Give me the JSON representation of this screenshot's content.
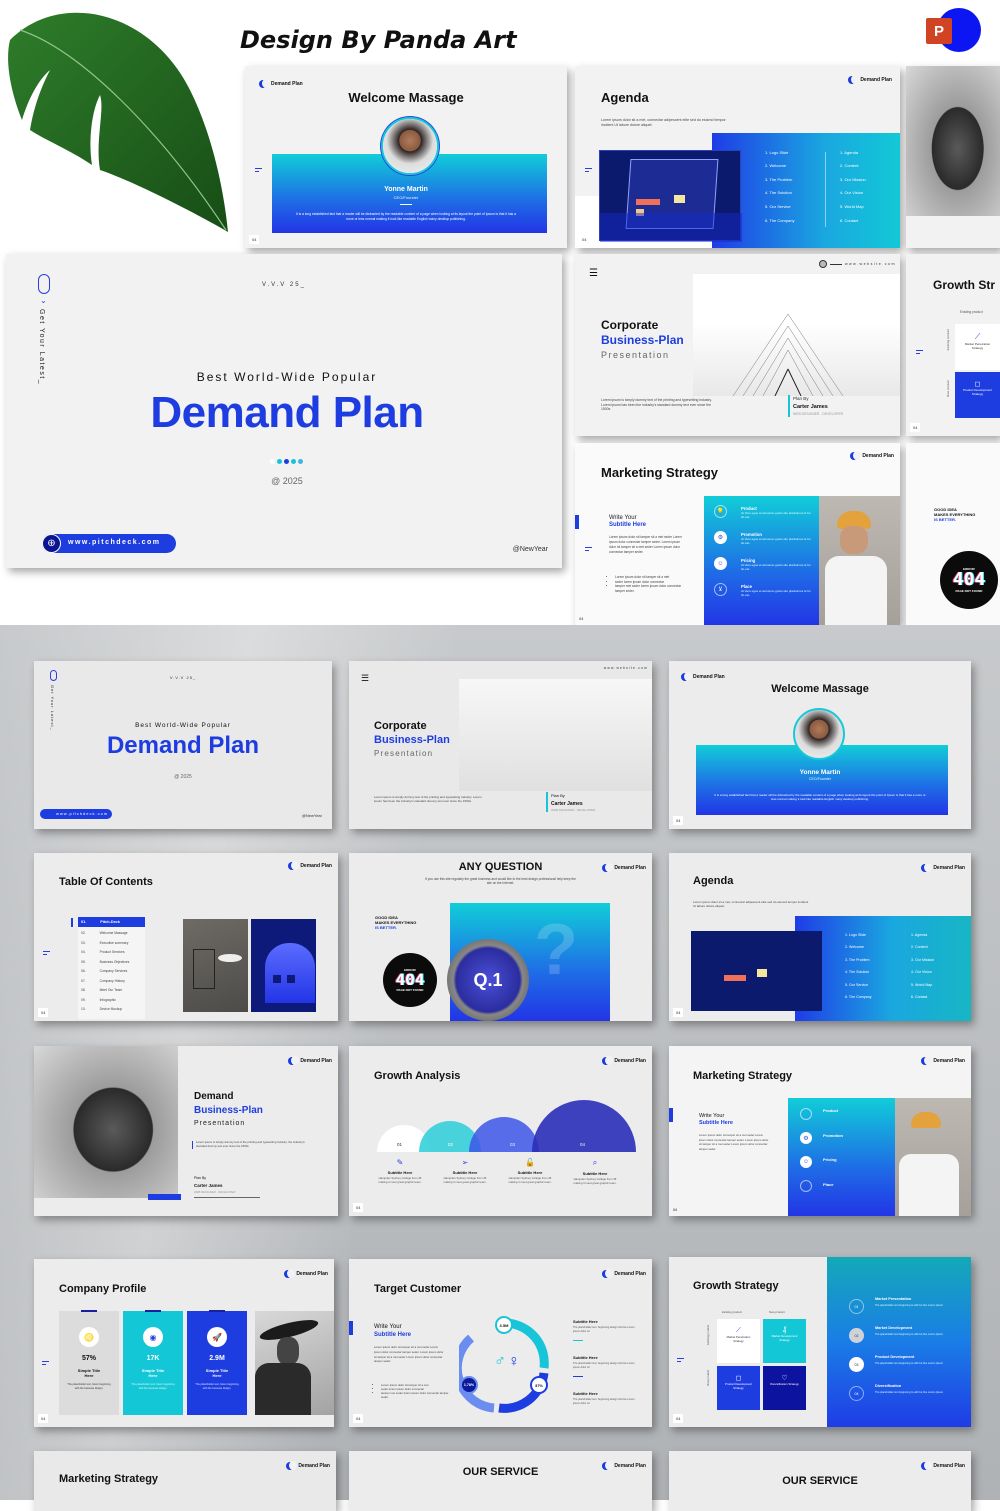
{
  "header": {
    "title": "Design By Panda Art",
    "file_icon": "powerpoint-icon",
    "file_badge": "P"
  },
  "colors": {
    "blue": "#1f3ce6",
    "cyan": "#12c9d6",
    "navy": "#1a1f9e",
    "bg": "#f2f2f2"
  },
  "brand": "Demand Plan",
  "page_number": "04",
  "cover": {
    "version": "V.V.V 25_",
    "side_text": "Get Your Latest_",
    "subtitle": "Best World-Wide Popular",
    "title": "Demand Plan",
    "year": "@ 2025",
    "url": "www.pitchdeck.com",
    "handle": "@NewYear"
  },
  "welcome": {
    "title": "Welcome Massage",
    "name": "Yonne Martin",
    "role": "CEO/Founder",
    "text": "It is a long established fact that a reader will be distracted by the readable content of a page when looking at its layout the point of Ipsum is that it has a more or less normal making it look like readable English many desktop publishing."
  },
  "agenda": {
    "title": "Agenda",
    "text": "Lorem ipsum dolor sit a met, connectar adipescent elite sed do eiusmd tempor incident Ut labore dolore aliquet.",
    "left": [
      "1. Logo Slide",
      "2. Welcome",
      "3. The Problem",
      "4. The Solution",
      "5. Our Service",
      "6. The Company"
    ],
    "right": [
      "1. Agenda",
      "2. Content",
      "3. Our Mission",
      "4. Our Vision",
      "5. World Map",
      "6. Contact"
    ]
  },
  "corporate": {
    "url": "www.website.com",
    "line1": "Corporate",
    "line2": "Business-Plan",
    "line3": "Presentation",
    "text": "Lorem ipsum is simply dummy text of the printing and typesetting industry. Lorem ipsum has been the industry's standard dummy text ever since the 1500s.",
    "plan_by": "Plan By",
    "author": "Carter James",
    "author_role": "WEB DESIGNER - DEVELOPER"
  },
  "growth_strategy": {
    "title": "Growth Strategy",
    "title_cropped": "Growth Str",
    "col_labels": [
      "Existing product",
      "New product"
    ],
    "row_labels": [
      "Existing product",
      "New product"
    ],
    "cells": [
      "Market Penetration Strategy",
      "Market Development Strategy",
      "Product Development Strategy",
      "Diversification Strategy"
    ],
    "steps": [
      {
        "num": "01",
        "title": "Market Presentation",
        "text": "The placeholder text beginning to with be fine Lorem Ipsum"
      },
      {
        "num": "02",
        "title": "Market Development",
        "text": "The placeholder text beginning to with be fine Lorem Ipsum"
      },
      {
        "num": "03",
        "title": "Product Development",
        "text": "The placeholder text beginning to with be fine Lorem Ipsum"
      },
      {
        "num": "04",
        "title": "Diversification",
        "text": "The placeholder text beginning to with be fine Lorem Ipsum"
      }
    ]
  },
  "marketing": {
    "title": "Marketing Strategy",
    "sub1": "Write Your",
    "sub2": "Subtitle Here",
    "text": "Lorem ipsum dolor sit tamper sit a met seder Lorem ipsum dolor connectar tamper seder. Lorem ipsum dolor sit tamper sit a met seder Lorem ipsum dolor connectar tamper seder.",
    "bullets": [
      "Lorem ipsum dolor sit tamper sit a met",
      "seder lorem ipsum dolor connectar",
      "tamper met seder lorem ipsum dolor connectar tamper seder."
    ],
    "items": [
      {
        "title": "Product",
        "text": "At Vero egos et accusmo gusto sito plantsimos le for Ito eto."
      },
      {
        "title": "Promotion",
        "text": "At Vero egos et accusmo gusto sito plantsimos le for Ito eto."
      },
      {
        "title": "Pricing",
        "text": "At Vero egos et accusmo gusto sito plantsimos le for Ito eto."
      },
      {
        "title": "Place",
        "text": "At Vero egos et accusmo gusto sito plantsimos le for Ito eto."
      }
    ]
  },
  "error": {
    "line1": "GOOD IDEA",
    "line2": "MAKES EVERYTHING",
    "line3": "IS BETTER.",
    "label": "ERROR!",
    "code": "404",
    "sub": "PAGE NOT FOUND"
  },
  "toc": {
    "title": "Table Of Contents",
    "items": [
      {
        "n": "01.",
        "t": "Pitch-Deck"
      },
      {
        "n": "02.",
        "t": "Welcome Massage"
      },
      {
        "n": "03.",
        "t": "Executive summary"
      },
      {
        "n": "04.",
        "t": "Product Services"
      },
      {
        "n": "05.",
        "t": "Business Objectives"
      },
      {
        "n": "06.",
        "t": "Company Services"
      },
      {
        "n": "07.",
        "t": "Company History"
      },
      {
        "n": "08.",
        "t": "Meet Our Team"
      },
      {
        "n": "09.",
        "t": "Infographic"
      },
      {
        "n": "10.",
        "t": "Device Mockup"
      }
    ]
  },
  "question": {
    "title": "ANY QUESTION",
    "text": "If you use this site regularly the great business and would like to the best design professional help keep the site on the Internet.",
    "badge": "Q.1",
    "mark": "?"
  },
  "demand_bp": {
    "line1": "Demand",
    "line2": "Business-Plan",
    "line3": "Presentation",
    "text": "Lorem ipsum is simply dummy text of the printing and typesetting industry. the industry's standard dummy text ever since the 1500s",
    "plan_by": "Plan By",
    "author": "Carter James",
    "author_role": "WEB DESIGNER - DEVELOPER"
  },
  "growth_analysis": {
    "title": "Growth Analysis",
    "steps": [
      {
        "num": "01",
        "icon": "pen-icon",
        "title": "Subtitle Here",
        "text": "Hampden Sydney College from 45 making it meet great graphic team."
      },
      {
        "num": "02",
        "icon": "paper-plane-icon",
        "title": "Subtitle Here",
        "text": "Hampden Sydney College from 45 making it meet great graphic team."
      },
      {
        "num": "03",
        "icon": "lock-icon",
        "title": "Subtitle Here",
        "text": "Hampden Sydney College from 45 making it meet great graphic team."
      },
      {
        "num": "04",
        "icon": "search-dollar-icon",
        "title": "Subtitle Here",
        "text": "Hampden Sydney College from 45 making it meet great graphic team."
      }
    ]
  },
  "company_profile": {
    "title": "Company Profile",
    "cards": [
      {
        "value": "57%",
        "title": "Simple Title Here",
        "text": "The placeholder text, lorem beginning with the because design."
      },
      {
        "value": "17K",
        "title": "Simple Title Here",
        "text": "The placeholder text, lorem beginning with the because design."
      },
      {
        "value": "2.9M",
        "title": "Simple Title Here",
        "text": "The placeholder text, lorem beginning with the because design."
      }
    ]
  },
  "target": {
    "title": "Target Customer",
    "sub1": "Write Your",
    "sub2": "Subtitle Here",
    "text": "Lorem ipsum dolor sit tamper sit a met seder Lorem ipsum dolor connectar tamper seder. Lorem ipsum dolor sit tamper sit a met seder Lorem ipsum dolor connectar tamper seder.",
    "bullets": [
      "Lorem ipsum dolor sit tamper sit a met",
      "seder lorem ipsum dolor connectar",
      "tamper met seder lorem ipsum dolor connectar tamper seder."
    ],
    "values": [
      "3.5M",
      "37%",
      "1.78%"
    ],
    "right": [
      {
        "title": "Subtitle Here",
        "text": "The placeholder text, beginning design the line Lorem ipsum dolor sit"
      },
      {
        "title": "Subtitle Here",
        "text": "The placeholder text, beginning design the line Lorem ipsum dolor sit"
      },
      {
        "title": "Subtitle Here",
        "text": "The placeholder text, beginning design the line Lorem ipsum dolor sit"
      }
    ]
  },
  "bottom_row": {
    "marketing": "Marketing Strategy",
    "service1": "OUR SERVICE",
    "service2": "OUR SERVICE"
  }
}
